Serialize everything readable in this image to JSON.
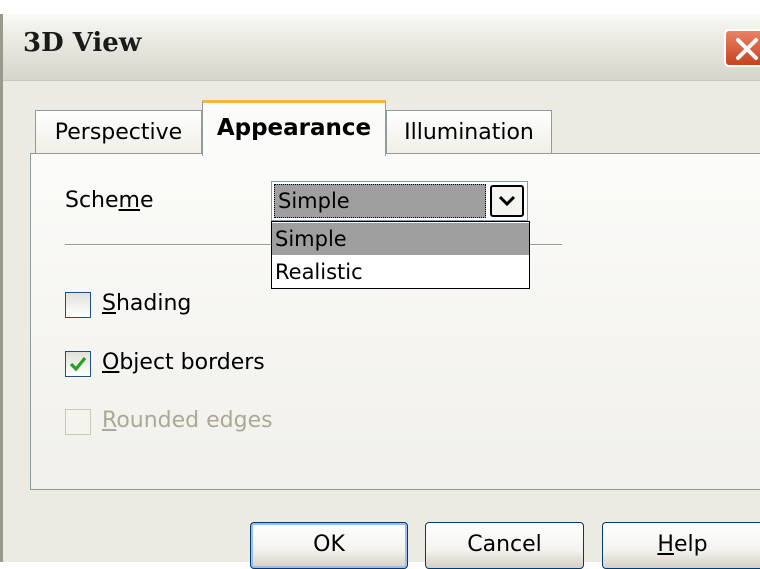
{
  "window": {
    "title": "3D View",
    "close_icon": "close-x-icon",
    "accent_close": "#d4562f"
  },
  "tabs": [
    {
      "label": "Perspective",
      "active": false
    },
    {
      "label": "Appearance",
      "active": true
    },
    {
      "label": "Illumination",
      "active": false
    }
  ],
  "scheme": {
    "label_pre": "Sche",
    "label_mnemonic": "m",
    "label_post": "e",
    "value": "Simple",
    "options": [
      "Simple",
      "Realistic"
    ],
    "selected_option": "Simple"
  },
  "checkboxes": {
    "shading": {
      "mnemonic": "S",
      "rest": "hading",
      "checked": false,
      "enabled": true
    },
    "object_borders": {
      "mnemonic": "O",
      "rest": "bject borders",
      "checked": true,
      "enabled": true
    },
    "rounded_edges": {
      "mnemonic": "R",
      "rest": "ounded edges",
      "checked": false,
      "enabled": false
    }
  },
  "buttons": {
    "ok": "OK",
    "cancel": "Cancel",
    "help_mnemonic": "H",
    "help_rest": "elp"
  },
  "colors": {
    "check_mark": "#21a121",
    "tab_highlight": "#f3b73a"
  }
}
